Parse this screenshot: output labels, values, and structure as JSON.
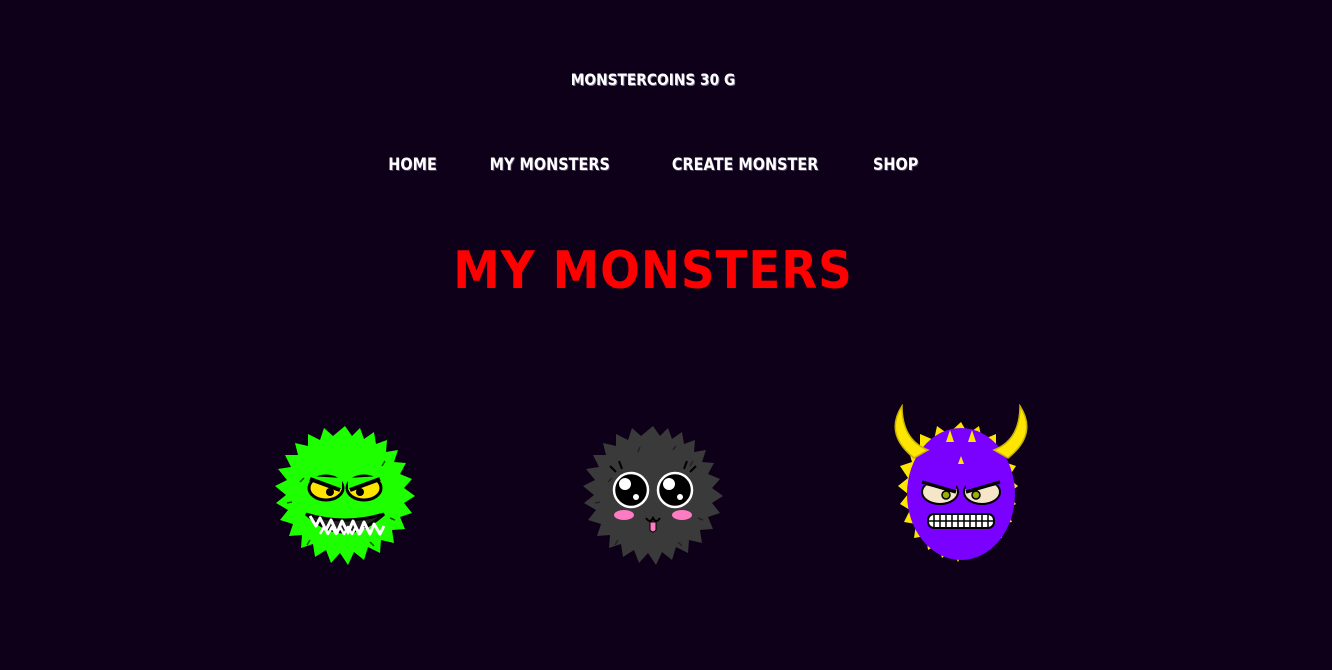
{
  "header": {
    "coins_label": "MONSTERCOINS 30 G"
  },
  "nav": {
    "items": [
      {
        "label": "HOME"
      },
      {
        "label": "MY MONSTERS"
      },
      {
        "label": "CREATE MONSTER"
      },
      {
        "label": "SHOP"
      }
    ]
  },
  "main": {
    "title": "MY MONSTERS",
    "monsters": [
      {
        "kind": "green-furry-monster",
        "color": "#1eff00"
      },
      {
        "kind": "black-furry-monster",
        "color": "#3a3a3a"
      },
      {
        "kind": "purple-horned-monster",
        "color": "#7a00ff"
      }
    ]
  },
  "colors": {
    "background": "#0d0018",
    "title": "#ff0000",
    "text": "#ffffff"
  }
}
